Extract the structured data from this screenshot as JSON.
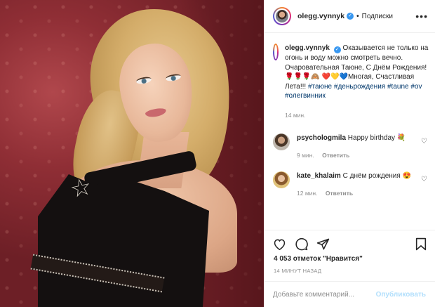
{
  "post": {
    "author": {
      "username": "olegg.vynnyk",
      "follow_separator": "•",
      "follow_label": "Подписки"
    },
    "caption": {
      "username": "olegg.vynnyk",
      "line1": "Оказывается не только на огонь и воду можно смотреть вечно. Очаровательная Таюне, С Днём Рождения!🌹🌹🌹🙈",
      "line2": "❤️💛💙Многая, Счастливая Лета!!!",
      "hashtags": "#таюне #деньрождения #taune #ov #олегвинник",
      "time": "14 мин."
    },
    "comments": [
      {
        "username": "psychologmila",
        "text": "Happy birthday 💐",
        "time": "9 мин.",
        "reply_label": "Ответить"
      },
      {
        "username": "kate_khalaim",
        "text": "С днём рождения 😍",
        "time": "12 мин.",
        "reply_label": "Ответить"
      }
    ],
    "likes_text": "4 053 отметок \"Нравится\"",
    "timestamp": "14 МИНУТ НАЗАД",
    "add_comment": {
      "placeholder": "Добавьте комментарий...",
      "publish_label": "Опубликовать"
    },
    "icons": {
      "more": "more-icon",
      "like": "heart-icon",
      "comment": "comment-icon",
      "share": "share-icon",
      "save": "bookmark-icon",
      "verified": "verified-icon"
    },
    "colors": {
      "verified": "#3897f0",
      "link": "#00376b",
      "muted": "#8e8e8e",
      "publish_disabled": "#b2dffc"
    }
  }
}
